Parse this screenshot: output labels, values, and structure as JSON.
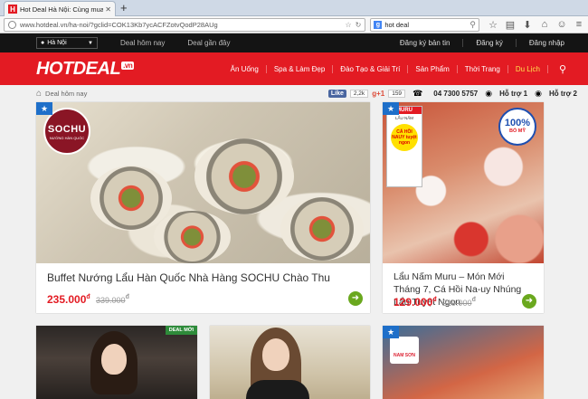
{
  "browser": {
    "tab_title": "Hot Deal Hà Nội: Cùng mua c...",
    "tab_favicon": "H",
    "new_tab": "+",
    "url": "www.hotdeal.vn/ha-noi/?gclid=COK13Kb7ycACFZotvQodP28AUg",
    "search_value": "hot deal",
    "search_engine_icon": "g"
  },
  "topbar": {
    "city": "Hà Nội",
    "links": [
      "Deal hôm nay",
      "Deal gần đây"
    ],
    "right": [
      "Đăng ký bản tin",
      "Đăng ký",
      "Đăng nhập"
    ]
  },
  "header": {
    "logo": "HOTDEAL",
    "logo_suffix": ".vn",
    "nav": [
      "Ăn Uống",
      "Spa & Làm Đẹp",
      "Đào Tạo & Giải Trí",
      "Sản Phẩm",
      "Thời Trang",
      "Du Lịch"
    ],
    "active_nav": "Du Lịch",
    "search_icon": "search-icon"
  },
  "subbar": {
    "breadcrumb": "Deal hôm nay",
    "fb_like": "Like",
    "fb_count": "2,2k",
    "gplus": "g+1",
    "gplus_count": "159",
    "phone": "04 7300 5757",
    "support1": "Hỗ trợ 1",
    "support2": "Hỗ trợ 2"
  },
  "deals": [
    {
      "title": "Buffet Nướng Lẩu Hàn Quốc Nhà Hàng SOCHU Chào Thu",
      "price": "235.000",
      "currency": "đ",
      "old_price": "339.000",
      "brand": "SOCHU",
      "brand_sub": "NƯỚNG HÀN QUỐC"
    },
    {
      "title": "Lẩu Nấm Muru – Món Mới Tháng 7, Cá Hồi Na-uy Nhúng Lẩu Tuyệt Ngon",
      "price": "129.000",
      "currency": "đ",
      "old_price": "219.000",
      "tag_head": "MURU",
      "tag_sub": "LẨU NẤM",
      "tag_circle": "CÁ HỒI NAUY tuyệt ngon",
      "badge_num": "100%",
      "badge_sub": "BÒ MỸ"
    }
  ],
  "row2": {
    "deal_moi": "DEAL MỚI",
    "namsun": "NAM SƠN"
  },
  "colors": {
    "brand_red": "#e31b23",
    "topbar_black": "#141414",
    "price_red": "#e31b23",
    "go_green": "#6aa81e",
    "star_blue": "#1e6fc9"
  }
}
